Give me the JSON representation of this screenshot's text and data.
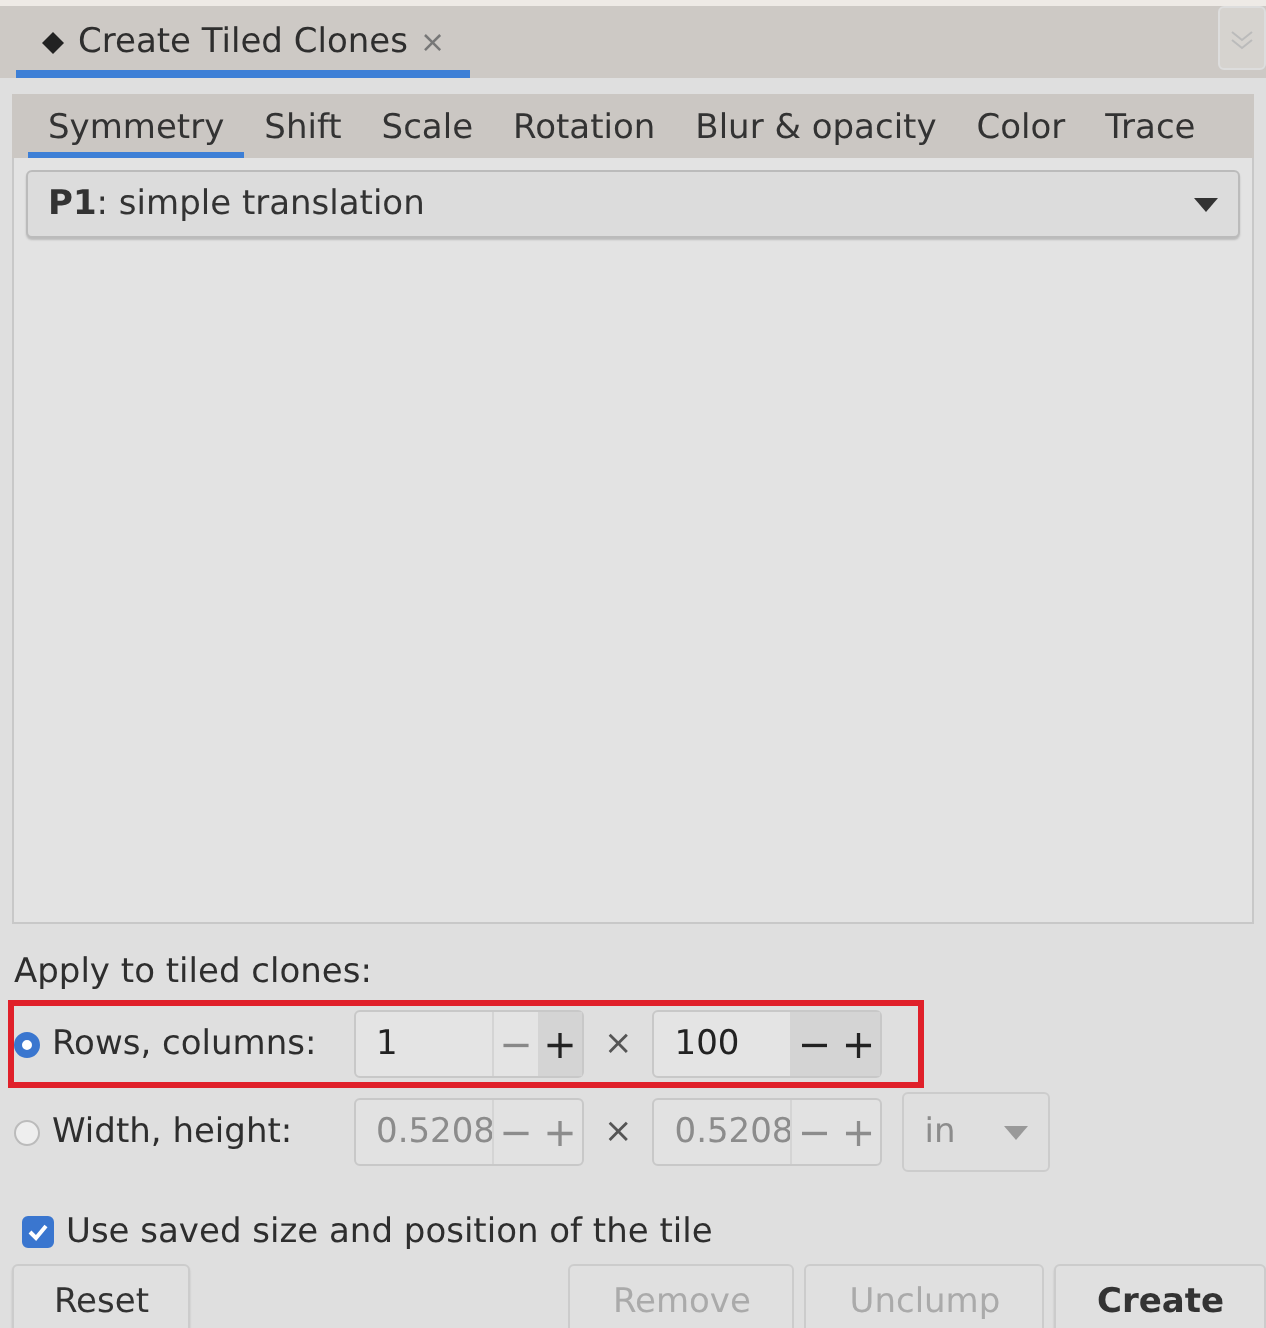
{
  "dock_tab": {
    "title": "Create Tiled Clones",
    "close": "×",
    "selected": true
  },
  "tabs": [
    {
      "label": "Symmetry",
      "selected": true
    },
    {
      "label": "Shift",
      "selected": false
    },
    {
      "label": "Scale",
      "selected": false
    },
    {
      "label": "Rotation",
      "selected": false
    },
    {
      "label": "Blur & opacity",
      "selected": false
    },
    {
      "label": "Color",
      "selected": false
    },
    {
      "label": "Trace",
      "selected": false
    }
  ],
  "symmetry": {
    "value": "**P1**: simple translation"
  },
  "apply_label": "Apply to tiled clones:",
  "modes": [
    {
      "label": "Rows, columns:",
      "selected": true,
      "highlighted": true,
      "separator": "×",
      "fields": [
        {
          "value": "1",
          "minus": "−",
          "plus": "+",
          "minus_disabled": true,
          "disabled": false
        },
        {
          "value": "100",
          "minus": "−",
          "plus": "+",
          "minus_disabled": false,
          "disabled": false
        }
      ]
    },
    {
      "label": "Width, height:",
      "selected": false,
      "highlighted": false,
      "separator": "×",
      "fields": [
        {
          "value": "0.5208",
          "minus": "−",
          "plus": "+",
          "disabled": true
        },
        {
          "value": "0.5208",
          "minus": "−",
          "plus": "+",
          "disabled": true
        }
      ],
      "unit": {
        "value": "in",
        "disabled": true
      }
    }
  ],
  "use_saved": {
    "label": "Use saved size and position of the tile",
    "checked": true
  },
  "buttons": [
    {
      "label": "Reset",
      "disabled": false,
      "default": false
    },
    {
      "label": "Remove",
      "disabled": true,
      "default": false
    },
    {
      "label": "Unclump",
      "disabled": true,
      "default": false
    },
    {
      "label": "Create",
      "disabled": false,
      "default": true
    }
  ]
}
